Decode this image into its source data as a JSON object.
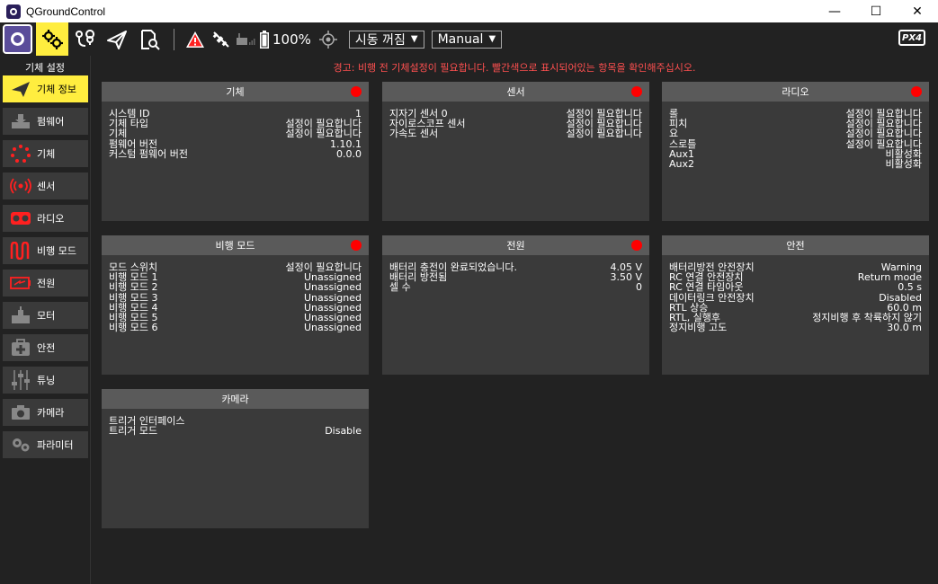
{
  "window": {
    "title": "QGroundControl",
    "minimize": "—",
    "maximize": "☐",
    "close": "✕"
  },
  "toolbar": {
    "battery": "100%",
    "flight_status": "시동 꺼짐",
    "flight_mode": "Manual",
    "logo": "PX4"
  },
  "sidebar": {
    "title": "기체 설정",
    "items": [
      {
        "label": "기체 정보",
        "icon": "paper-plane-icon"
      },
      {
        "label": "펌웨어",
        "icon": "download-icon"
      },
      {
        "label": "기체",
        "icon": "airframe-icon"
      },
      {
        "label": "센서",
        "icon": "sensor-icon"
      },
      {
        "label": "라디오",
        "icon": "radio-icon"
      },
      {
        "label": "비행 모드",
        "icon": "flight-modes-icon"
      },
      {
        "label": "전원",
        "icon": "battery-icon"
      },
      {
        "label": "모터",
        "icon": "motor-icon"
      },
      {
        "label": "안전",
        "icon": "safety-icon"
      },
      {
        "label": "튜닝",
        "icon": "tuning-icon"
      },
      {
        "label": "카메라",
        "icon": "camera-icon"
      },
      {
        "label": "파라미터",
        "icon": "parameters-icon"
      }
    ]
  },
  "warning": "경고: 비행 전 기체설정이 필요합니다. 빨간색으로 표시되어있는 항목을 확인해주십시오.",
  "panels": {
    "airframe": {
      "title": "기체",
      "rows": [
        {
          "label": "시스템 ID",
          "value": "1"
        },
        {
          "label": "기체 타입",
          "value": "설정이 필요합니다"
        },
        {
          "label": "기체",
          "value": "설정이 필요합니다"
        },
        {
          "label": "펌웨어 버전",
          "value": "1.10.1"
        },
        {
          "label": "커스텀 펌웨어 버전",
          "value": "0.0.0"
        }
      ]
    },
    "sensors": {
      "title": "센서",
      "rows": [
        {
          "label": "지자기 센서 0",
          "value": "설정이 필요합니다"
        },
        {
          "label": "자이로스코프 센서",
          "value": "설정이 필요합니다"
        },
        {
          "label": "가속도 센서",
          "value": "설정이 필요합니다"
        }
      ]
    },
    "radio": {
      "title": "라디오",
      "rows": [
        {
          "label": "롤",
          "value": "설정이 필요합니다"
        },
        {
          "label": "피치",
          "value": "설정이 필요합니다"
        },
        {
          "label": "요",
          "value": "설정이 필요합니다"
        },
        {
          "label": "스로틀",
          "value": "설정이 필요합니다"
        },
        {
          "label": "Aux1",
          "value": "비활성화"
        },
        {
          "label": "Aux2",
          "value": "비활성화"
        }
      ]
    },
    "flight_modes": {
      "title": "비행 모드",
      "rows": [
        {
          "label": "모드 스위치",
          "value": "설정이 필요합니다"
        },
        {
          "label": "비행 모드 1",
          "value": "Unassigned"
        },
        {
          "label": "비행 모드 2",
          "value": "Unassigned"
        },
        {
          "label": "비행 모드 3",
          "value": "Unassigned"
        },
        {
          "label": "비행 모드 4",
          "value": "Unassigned"
        },
        {
          "label": "비행 모드 5",
          "value": "Unassigned"
        },
        {
          "label": "비행 모드 6",
          "value": "Unassigned"
        }
      ]
    },
    "power": {
      "title": "전원",
      "rows": [
        {
          "label": "배터리 충전이 완료되었습니다.",
          "value": "4.05 V"
        },
        {
          "label": "배터리 방전됨",
          "value": "3.50 V"
        },
        {
          "label": "셀 수",
          "value": "0"
        }
      ]
    },
    "safety": {
      "title": "안전",
      "rows": [
        {
          "label": "배터리방전 안전장치",
          "value": "Warning"
        },
        {
          "label": "RC 연결 안전장치",
          "value": "Return mode"
        },
        {
          "label": "RC 연결 타임아웃",
          "value": "0.5 s"
        },
        {
          "label": "데이터링크 안전장치",
          "value": "Disabled"
        },
        {
          "label": "RTL 상승",
          "value": "60.0 m"
        },
        {
          "label": "RTL, 실행후",
          "value": "정지비행 후 착륙하지 않기"
        },
        {
          "label": "정지비행 고도",
          "value": "30.0 m"
        }
      ]
    },
    "camera": {
      "title": "카메라",
      "rows": [
        {
          "label": "트리거 인터페이스",
          "value": ""
        },
        {
          "label": "트리거 모드",
          "value": "Disable"
        }
      ]
    }
  },
  "colors": {
    "accent": "#ffed3f",
    "warning": "#ff5050",
    "status_red": "#ff0000",
    "panel_bg": "#3a3a3a",
    "panel_header": "#5a5a5a"
  }
}
